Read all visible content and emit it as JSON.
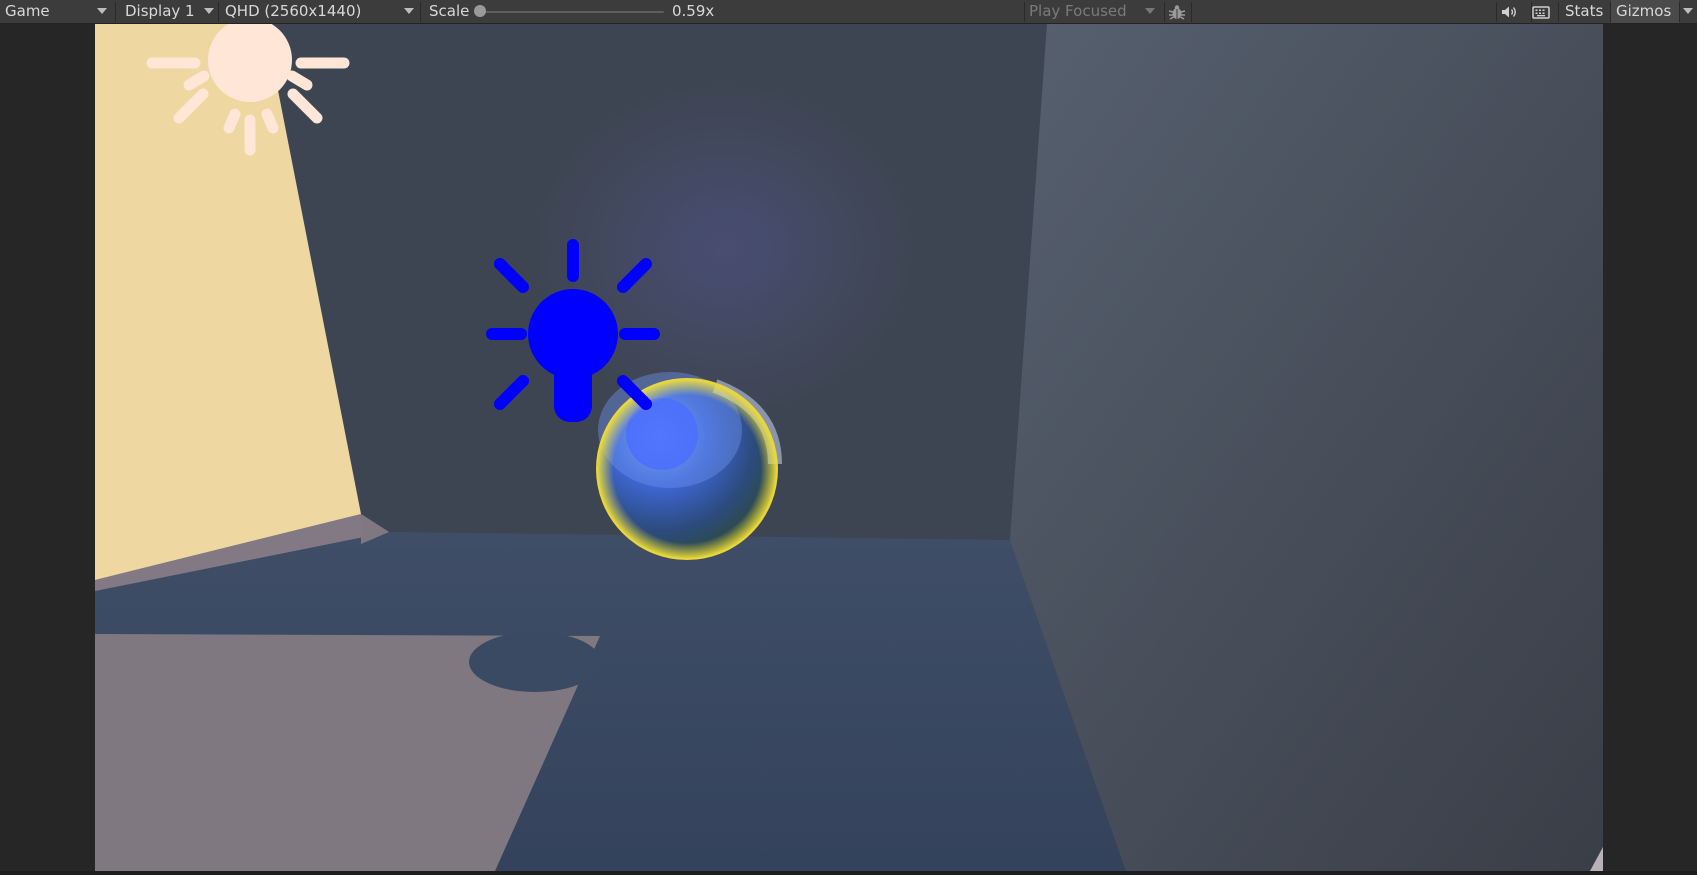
{
  "toolbar": {
    "view_mode": "Game",
    "display": "Display 1",
    "resolution": "QHD (2560x1440)",
    "scale_label": "Scale",
    "scale_value": "0.59x",
    "scale_fraction": 0.0,
    "play_mode": "Play Focused",
    "stats_label": "Stats",
    "gizmos_label": "Gizmos",
    "icons": [
      "debug-bug-icon",
      "audio-speaker-icon",
      "keyboard-icon"
    ]
  },
  "scene": {
    "gizmos": [
      "directional-light-sun-icon",
      "point-light-bulb-icon"
    ],
    "objects": [
      "glass-sphere"
    ],
    "colors": {
      "sun_gizmo": "#ffe6d6",
      "bulb_gizmo": "#0000ff",
      "back_wall": "#3e4552",
      "side_wall": "#4c5563",
      "floor": "#3b4a63",
      "lit_wall": "#efd7a1",
      "lit_floor": "#807881",
      "sphere_rim": "#f1e03a"
    }
  }
}
